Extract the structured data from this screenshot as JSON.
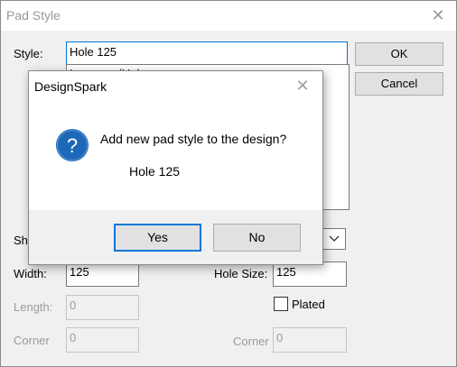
{
  "window": {
    "title": "Pad Style",
    "close_icon": "close-icon",
    "close_glyph": "✕"
  },
  "form": {
    "style_label": "Style:",
    "style_value": "Hole 125",
    "list_partial_item": "Lozenge (Hole",
    "shape_label_partial": "Sh",
    "width_label": "Width:",
    "width_value": "125",
    "hole_size_label": "Hole Size:",
    "hole_size_value": "125",
    "length_label": "Length:",
    "length_value": "0",
    "corner_label": "Corner",
    "corner_value": "0",
    "corner2_label": "Corner",
    "corner2_value": "0",
    "plated_label": "Plated",
    "plated_checked": false
  },
  "buttons": {
    "ok": "OK",
    "cancel": "Cancel"
  },
  "message_box": {
    "title": "DesignSpark",
    "close_icon": "close-icon",
    "close_glyph": "✕",
    "icon": "question-icon",
    "icon_glyph": "?",
    "question": "Add new pad style to the design?",
    "detail": "Hole 125",
    "yes": "Yes",
    "no": "No"
  },
  "colors": {
    "accent": "#0078d7",
    "icon_fill": "#1d68b8",
    "disabled_text": "#9b9b9b"
  }
}
